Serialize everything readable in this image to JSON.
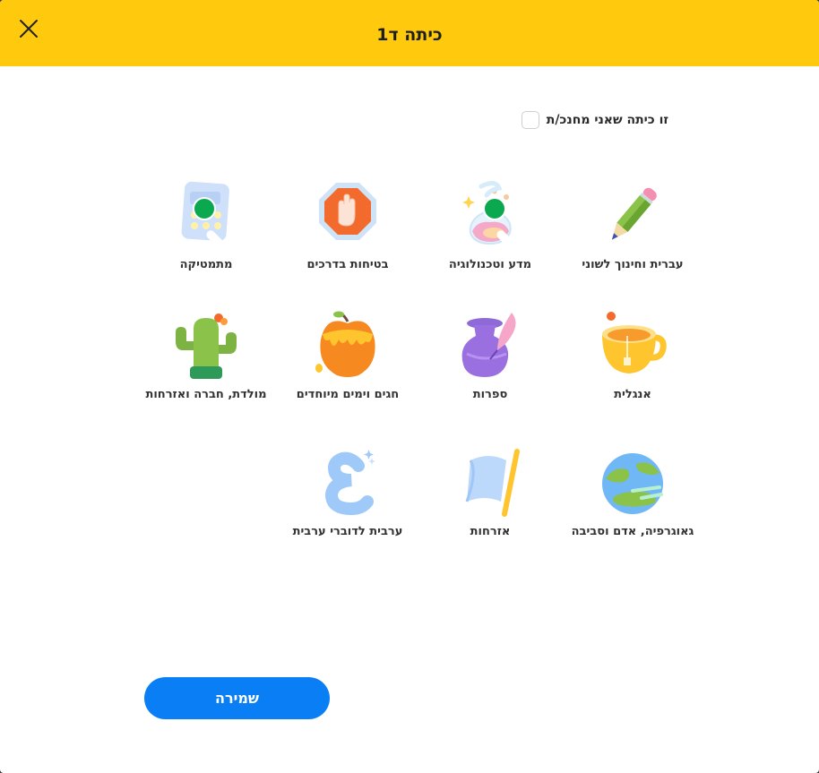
{
  "header": {
    "title": "כיתה ד1",
    "close_icon": "close-icon",
    "background": "#ffc90e"
  },
  "teacher_checkbox": {
    "label": "זו כיתה שאני מחנכ/ת",
    "checked": false
  },
  "subjects": [
    {
      "label": "עברית וחינוך לשוני",
      "icon": "pencil-icon",
      "selected": false
    },
    {
      "label": "מדע וטכנולוגיה",
      "icon": "flask-icon",
      "selected": true
    },
    {
      "label": "בטיחות בדרכים",
      "icon": "stop-hand-icon",
      "selected": false
    },
    {
      "label": "מתמטיקה",
      "icon": "calculator-icon",
      "selected": true
    },
    {
      "label": "אנגלית",
      "icon": "teacup-icon",
      "selected": false
    },
    {
      "label": "ספרות",
      "icon": "inkpot-quill-icon",
      "selected": false
    },
    {
      "label": "חגים וימים מיוחדים",
      "icon": "apple-honey-icon",
      "selected": false
    },
    {
      "label": "מולדת, חברה ואזרחות",
      "icon": "cactus-icon",
      "selected": false
    },
    {
      "label": "גאוגרפיה, אדם וסביבה",
      "icon": "globe-icon",
      "selected": false
    },
    {
      "label": "אזרחות",
      "icon": "flag-icon",
      "selected": false
    },
    {
      "label": "ערבית לדוברי ערבית",
      "icon": "arabic-letter-icon",
      "selected": false
    }
  ],
  "save_button": {
    "label": "שמירה",
    "color": "#0a7ff5"
  },
  "colors": {
    "selected_check": "#0aa84f"
  }
}
